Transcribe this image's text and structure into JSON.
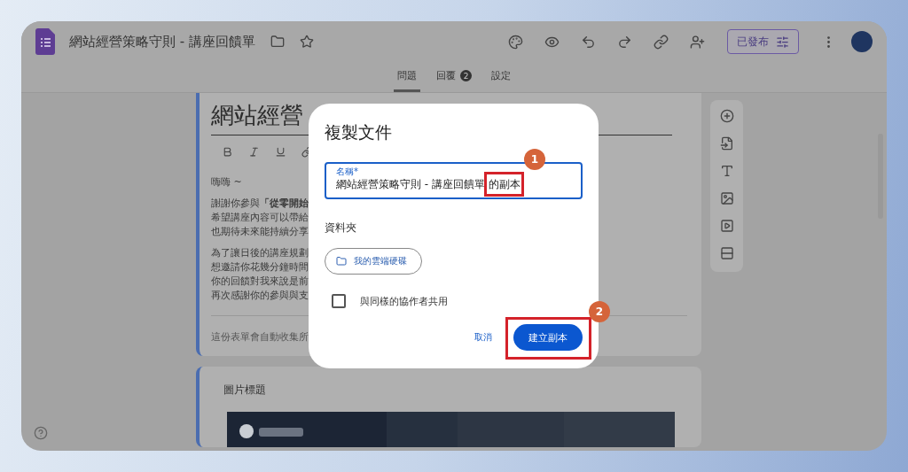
{
  "app": {
    "title": "網站經營策略守則 - 講座回饋單",
    "publish_button": "已發布"
  },
  "tabs": [
    {
      "label": "問題",
      "selected": true
    },
    {
      "label": "回覆",
      "selected": false,
      "badge": "2"
    },
    {
      "label": "設定",
      "selected": false
    }
  ],
  "form_card": {
    "title": "網站經營",
    "paragraphs": [
      [
        "嗨嗨 ~"
      ],
      [
        "謝謝你參與**「從零開始**",
        "希望講座內容可以帶給",
        "也期待未來能持續分享"
      ],
      [
        "為了讓日後的講座規劃",
        "想邀請你花幾分鐘時間",
        "你的回饋對我來說是前",
        "再次感謝你的參與與支"
      ]
    ],
    "footer": "這份表單會自動收集所"
  },
  "image_card": {
    "title": "圖片標題"
  },
  "dialog": {
    "title": "複製文件",
    "name_field": {
      "label": "名稱*",
      "value": "網站經營策略守則 - 講座回饋單 的副本"
    },
    "folder_label": "資料夾",
    "folder_button": "我的雲端硬碟",
    "share_checkbox": {
      "label": "與同樣的協作者共用",
      "checked": false
    },
    "cancel_button": "取消",
    "confirm_button": "建立副本"
  },
  "annotations": [
    {
      "number": "1"
    },
    {
      "number": "2"
    }
  ]
}
